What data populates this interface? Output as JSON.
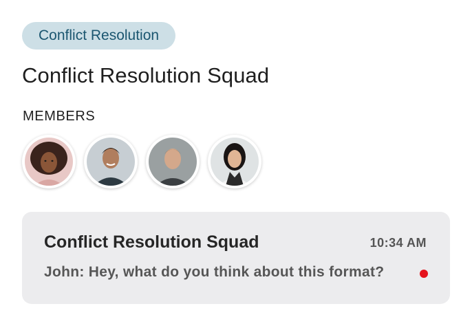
{
  "group": {
    "tag": "Conflict Resolution",
    "title": "Conflict Resolution Squad",
    "members_label": "MEMBERS",
    "members": [
      {
        "icon": "avatar-member-1"
      },
      {
        "icon": "avatar-member-2"
      },
      {
        "icon": "avatar-member-3"
      },
      {
        "icon": "avatar-member-4"
      }
    ]
  },
  "chat": {
    "name": "Conflict Resolution Squad",
    "time": "10:34 AM",
    "preview": "John: Hey, what do you think about this format?",
    "unread": true,
    "unread_color": "#e5131d"
  },
  "colors": {
    "tag_bg": "#cddfe6",
    "tag_text": "#1b5670",
    "card_bg": "#ececee"
  }
}
